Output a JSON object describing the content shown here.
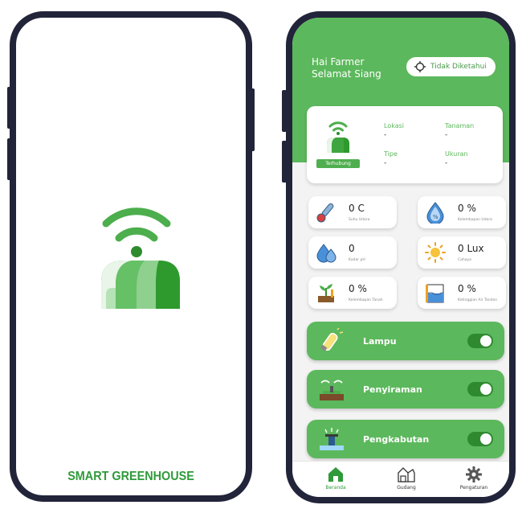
{
  "splash": {
    "title": "SMART GREENHOUSE"
  },
  "dashboard": {
    "greeting_line1": "Hai Farmer",
    "greeting_line2": "Selamat Siang",
    "location_button": "Tidak Diketahui",
    "status_badge": "Terhubung",
    "info": {
      "lokasi_label": "Lokasi",
      "lokasi_value": "-",
      "tanaman_label": "Tanaman",
      "tanaman_value": "-",
      "tipe_label": "Tipe",
      "tipe_value": "-",
      "ukuran_label": "Ukuran",
      "ukuran_value": "-"
    },
    "sensors": [
      {
        "value": "0 C",
        "label": "Suhu Udara",
        "icon": "thermometer-icon"
      },
      {
        "value": "0 %",
        "label": "Kelembapan Udara",
        "icon": "humidity-drop-icon"
      },
      {
        "value": "0",
        "label": "Kadar pH",
        "icon": "ph-drop-icon"
      },
      {
        "value": "0 Lux",
        "label": "Cahaya",
        "icon": "sun-icon"
      },
      {
        "value": "0 %",
        "label": "Kelembapan Tanah",
        "icon": "plant-soil-icon"
      },
      {
        "value": "0 %",
        "label": "Ketinggian Air Tandon",
        "icon": "water-level-icon"
      }
    ],
    "controls": [
      {
        "name": "Lampu",
        "on": true
      },
      {
        "name": "Penyiraman",
        "on": true
      },
      {
        "name": "Pengkabutan",
        "on": true
      }
    ],
    "nav": {
      "beranda": "Beranda",
      "gudang": "Gudang",
      "pengaturan": "Pengaturan"
    }
  },
  "colors": {
    "primary_green": "#5cb85c",
    "dark_green": "#2f8a2f",
    "frame": "#22243a"
  }
}
